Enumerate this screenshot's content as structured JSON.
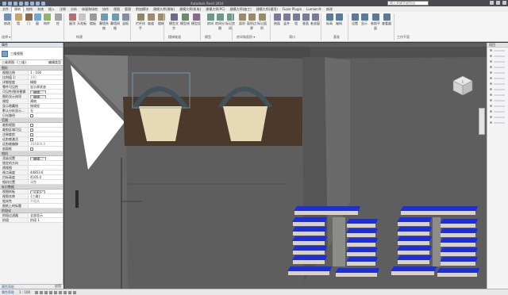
{
  "titlebar": {
    "title": "Autodesk Revit 2016",
    "search_placeholder": "键入关键字或短语"
  },
  "menu": {
    "tabs": [
      "文件",
      "建筑",
      "结构",
      "系统",
      "插入",
      "注释",
      "分析",
      "体量和场地",
      "协作",
      "视图",
      "管理",
      "附加模块",
      "建模大师(建筑)",
      "建模大师(机电)",
      "建模大师(PC)",
      "建模大师(施工)",
      "建模大师(通用)",
      "Fuzor Plugin",
      "Lumion®",
      "修改"
    ],
    "active_index": 1
  },
  "ribbon": {
    "tools": [
      {
        "label": "修改",
        "color": "#6f8fb8"
      },
      {
        "label": "墙",
        "color": "#c9a36a"
      },
      {
        "label": "门",
        "color": "#8a6a4a"
      },
      {
        "label": "窗",
        "color": "#6fa6d6"
      },
      {
        "label": "构件",
        "color": "#8fb36f"
      },
      {
        "label": "柱",
        "color": "#a3a3a3"
      },
      {
        "label": "屋顶",
        "color": "#b36f6f"
      },
      {
        "label": "天花板",
        "color": "#c6c6c6"
      },
      {
        "label": "楼板",
        "color": "#9a9a9a"
      },
      {
        "label": "幕墙系统",
        "color": "#6f9ab3"
      },
      {
        "label": "幕墙网格",
        "color": "#6f9ab3"
      },
      {
        "label": "竖梃",
        "color": "#7f8f9f"
      },
      {
        "label": "栏杆扶手",
        "color": "#8a8a6a"
      },
      {
        "label": "坡道",
        "color": "#a08a6a"
      },
      {
        "label": "楼梯",
        "color": "#a08a6a"
      },
      {
        "label": "模型文字",
        "color": "#6a6a8a"
      },
      {
        "label": "模型线",
        "color": "#6a8a6a"
      },
      {
        "label": "模型组",
        "color": "#8a6a8a"
      },
      {
        "label": "房间",
        "color": "#6a9a8a"
      },
      {
        "label": "房间分隔",
        "color": "#6a9a8a"
      },
      {
        "label": "标记房间",
        "color": "#6a9a8a"
      },
      {
        "label": "面积",
        "color": "#9a8a6a"
      },
      {
        "label": "面积边界",
        "color": "#9a8a6a"
      },
      {
        "label": "标记面积",
        "color": "#9a8a6a"
      },
      {
        "label": "按面",
        "color": "#7a7a9a"
      },
      {
        "label": "竖井",
        "color": "#7a7a9a"
      },
      {
        "label": "墙",
        "color": "#7a7a9a"
      },
      {
        "label": "垂直",
        "color": "#7a7a9a"
      },
      {
        "label": "老虎窗",
        "color": "#7a7a9a"
      },
      {
        "label": "标高",
        "color": "#5a7a9a"
      },
      {
        "label": "轴网",
        "color": "#5a7a9a"
      },
      {
        "label": "设置",
        "color": "#5a7a9a"
      },
      {
        "label": "显示",
        "color": "#5a7a9a"
      },
      {
        "label": "参照平面",
        "color": "#5a7a9a"
      },
      {
        "label": "查看器",
        "color": "#5a7a9a"
      }
    ],
    "groups": [
      {
        "label": "选择 ▾"
      },
      {
        "label": "构建"
      },
      {
        "label": "楼梯坡道"
      },
      {
        "label": "模型"
      },
      {
        "label": "房间和面积 ▾"
      },
      {
        "label": "洞口"
      },
      {
        "label": "基准"
      },
      {
        "label": "工作平面"
      }
    ]
  },
  "properties": {
    "header": "属性",
    "type_name": "三维视图",
    "view_selector": "三维视图: {三维}",
    "edit_type": "编辑类型",
    "sections": [
      {
        "title": "图形",
        "rows": [
          {
            "k": "视图比例",
            "v": "1 : 100"
          },
          {
            "k": "比例值 1:",
            "v": "100",
            "grey": true
          },
          {
            "k": "详细程度",
            "v": "精细"
          },
          {
            "k": "零件可见性",
            "v": "显示原状态"
          },
          {
            "k": "可见性/图形替换",
            "v": "编辑...",
            "button": true
          },
          {
            "k": "图形显示选项",
            "v": "编辑...",
            "button": true
          },
          {
            "k": "规程",
            "v": "建筑"
          },
          {
            "k": "显示隐藏线",
            "v": "按规程"
          },
          {
            "k": "默认分析显示...",
            "v": "无"
          },
          {
            "k": "日光路径",
            "v": "",
            "check": true
          }
        ]
      },
      {
        "title": "范围",
        "rows": [
          {
            "k": "裁剪视图",
            "v": "",
            "check": true
          },
          {
            "k": "裁剪区域可见",
            "v": "",
            "check": true
          },
          {
            "k": "注释裁剪",
            "v": "",
            "check": true
          },
          {
            "k": "远剪裁激活",
            "v": "",
            "check": true
          },
          {
            "k": "远剪裁偏移",
            "v": "304800.0",
            "grey": true
          },
          {
            "k": "剖面框",
            "v": "",
            "check": true
          }
        ]
      },
      {
        "title": "相机",
        "rows": [
          {
            "k": "渲染设置",
            "v": "编辑...",
            "button": true
          },
          {
            "k": "锁定的方向",
            "v": "",
            "grey": true
          },
          {
            "k": "透视图",
            "v": "",
            "grey": true
          },
          {
            "k": "视点高度",
            "v": "44853.6"
          },
          {
            "k": "目标高度",
            "v": "4165.0"
          },
          {
            "k": "相机位置",
            "v": "调整",
            "grey": true
          }
        ]
      },
      {
        "title": "标识数据",
        "rows": [
          {
            "k": "视图样板",
            "v": "<无>",
            "button": true
          },
          {
            "k": "视图名称",
            "v": "{三维}"
          },
          {
            "k": "相关性",
            "v": "不相关",
            "grey": true
          },
          {
            "k": "图纸上的标题",
            "v": ""
          }
        ]
      },
      {
        "title": "阶段化",
        "rows": [
          {
            "k": "阶段过滤器",
            "v": "全部显示"
          },
          {
            "k": "阶段",
            "v": "阶段 1"
          }
        ]
      }
    ],
    "help_link": "属性帮助",
    "apply": "应用"
  },
  "right_rail": {
    "title": "项目",
    "item_count": 14
  },
  "viewport": {
    "view_cube_label": "上"
  },
  "status": {
    "scale": "1 : 100"
  },
  "colors": {
    "roof_blue": "#1f2fd6",
    "hall_cream": "#e8dcb6",
    "floor_brown": "#4a3a2c",
    "ground_grey": "#626262"
  }
}
